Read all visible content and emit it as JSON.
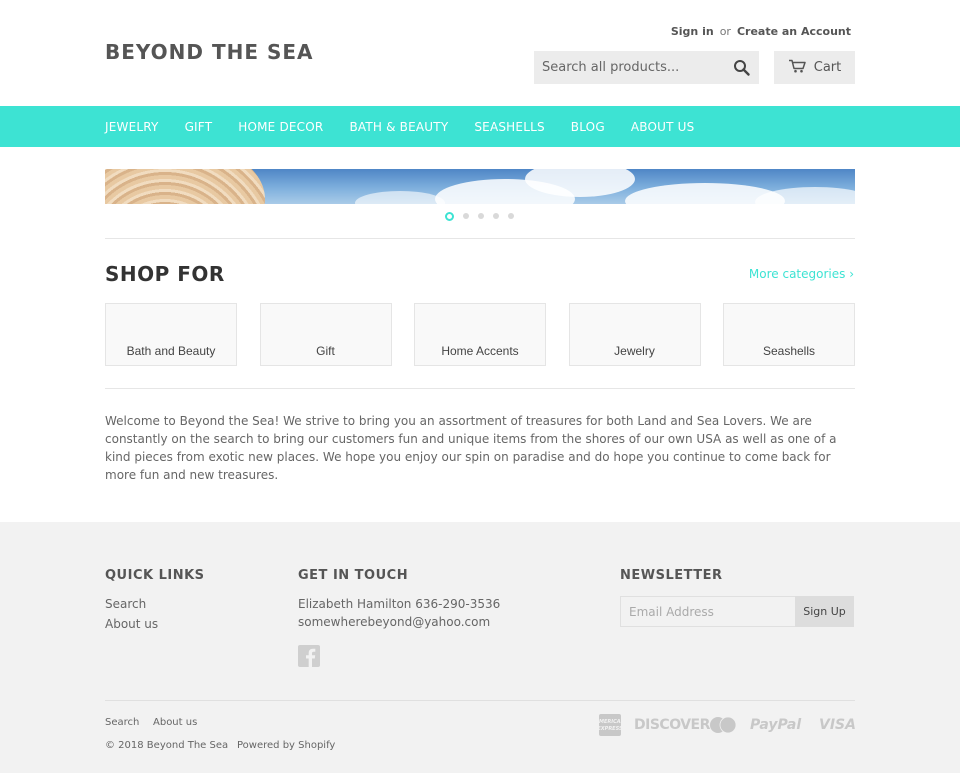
{
  "header": {
    "logo": "BEYOND THE SEA",
    "sign_in": "Sign in",
    "or": "or",
    "create_account": "Create an Account",
    "search_placeholder": "Search all products...",
    "cart_label": "Cart"
  },
  "nav": {
    "items": [
      {
        "label": "JEWELRY"
      },
      {
        "label": "GIFT"
      },
      {
        "label": "HOME DECOR"
      },
      {
        "label": "BATH & BEAUTY"
      },
      {
        "label": "SEASHELLS"
      },
      {
        "label": "BLOG"
      },
      {
        "label": "ABOUT US"
      }
    ]
  },
  "slideshow": {
    "slide_count": 5,
    "active_index": 0
  },
  "shop": {
    "title": "SHOP FOR",
    "more_link": "More categories ›",
    "categories": [
      {
        "label": "Bath and Beauty"
      },
      {
        "label": "Gift"
      },
      {
        "label": "Home Accents"
      },
      {
        "label": "Jewelry"
      },
      {
        "label": "Seashells"
      }
    ]
  },
  "welcome_text": "Welcome to Beyond the Sea! We strive to bring you an assortment of treasures for both Land and Sea Lovers. We are constantly on the search to bring our customers fun and unique items from the shores of our own USA as well as one of a kind pieces from exotic new places. We hope you enjoy our spin on paradise and do hope you continue to come back for more fun and new treasures.",
  "footer": {
    "quick_links": {
      "heading": "QUICK LINKS",
      "links": [
        {
          "label": "Search"
        },
        {
          "label": "About us"
        }
      ]
    },
    "contact": {
      "heading": "GET IN TOUCH",
      "name_phone": "Elizabeth Hamilton 636-290-3536",
      "email": "somewherebeyond@yahoo.com"
    },
    "newsletter": {
      "heading": "NEWSLETTER",
      "email_placeholder": "Email Address",
      "signup_label": "Sign Up"
    },
    "bottom_links": [
      {
        "label": "Search"
      },
      {
        "label": "About us"
      }
    ],
    "copyright": "© 2018 Beyond The Sea",
    "powered": "Powered by Shopify",
    "payment_icons": [
      "american-express",
      "DISCOVER",
      "mastercard",
      "PayPal",
      "VISA"
    ]
  },
  "colors": {
    "accent": "#3de3d3",
    "footer_bg": "#f2f2f2"
  }
}
